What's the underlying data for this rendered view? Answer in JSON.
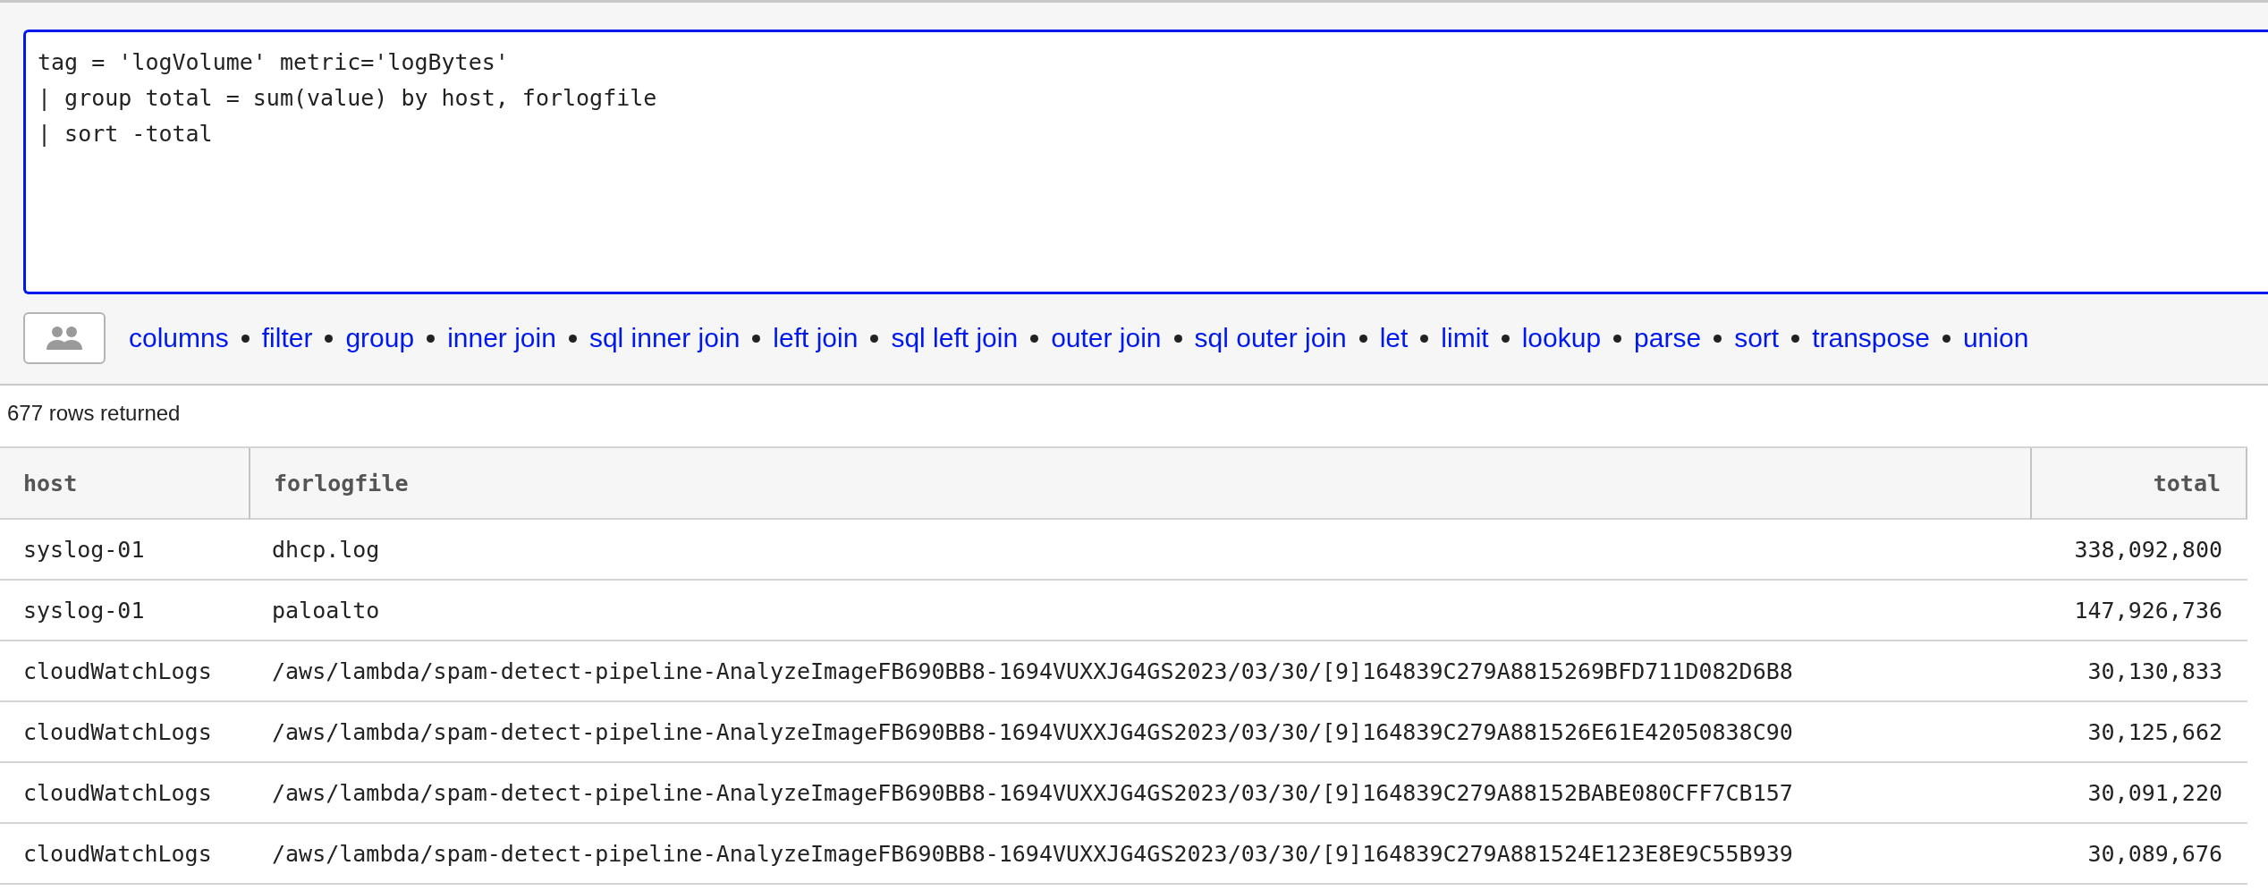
{
  "query_editor": {
    "lines": [
      "tag = 'logVolume' metric='logBytes'",
      "| group total = sum(value) by host, forlogfile",
      "| sort -total"
    ]
  },
  "commands": [
    "columns",
    "filter",
    "group",
    "inner join",
    "sql inner join",
    "left join",
    "sql left join",
    "outer join",
    "sql outer join",
    "let",
    "limit",
    "lookup",
    "parse",
    "sort",
    "transpose",
    "union"
  ],
  "row_count": "677 rows returned",
  "table": {
    "columns": [
      "host",
      "forlogfile",
      "total"
    ],
    "rows": [
      [
        "syslog-01",
        "dhcp.log",
        "338,092,800"
      ],
      [
        "syslog-01",
        "paloalto",
        "147,926,736"
      ],
      [
        "cloudWatchLogs",
        "/aws/lambda/spam-detect-pipeline-AnalyzeImageFB690BB8-1694VUXXJG4GS2023/03/30/[9]164839C279A8815269BFD711D082D6B8",
        "30,130,833"
      ],
      [
        "cloudWatchLogs",
        "/aws/lambda/spam-detect-pipeline-AnalyzeImageFB690BB8-1694VUXXJG4GS2023/03/30/[9]164839C279A881526E61E42050838C90",
        "30,125,662"
      ],
      [
        "cloudWatchLogs",
        "/aws/lambda/spam-detect-pipeline-AnalyzeImageFB690BB8-1694VUXXJG4GS2023/03/30/[9]164839C279A88152BABE080CFF7CB157",
        "30,091,220"
      ],
      [
        "cloudWatchLogs",
        "/aws/lambda/spam-detect-pipeline-AnalyzeImageFB690BB8-1694VUXXJG4GS2023/03/30/[9]164839C279A881524E123E8E9C55B939",
        "30,089,676"
      ]
    ]
  }
}
